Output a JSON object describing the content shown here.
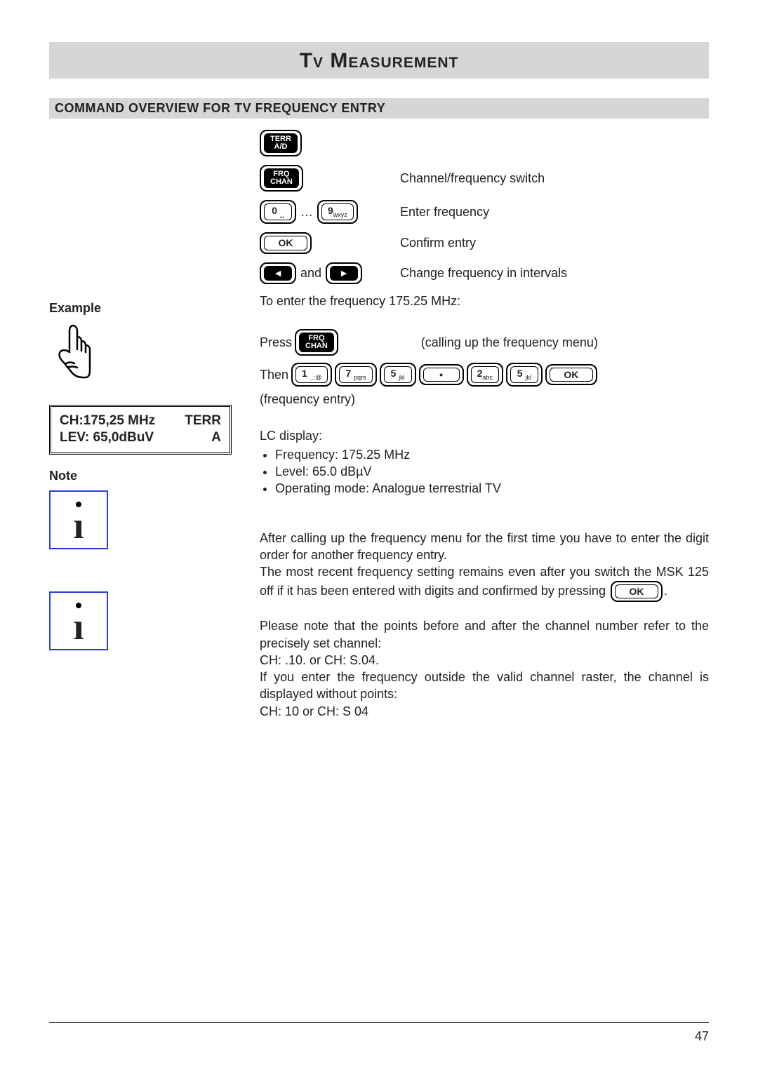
{
  "title": "Tv Measurement",
  "section_heading": "Command Overview for TV Frequency Entry",
  "commands": {
    "terr_key_line1": "TERR",
    "terr_key_line2": "A/D",
    "frq_key_line1": "FRQ",
    "frq_key_line2": "CHAN",
    "frq_desc": "Channel/frequency switch",
    "zero_key": "0",
    "zero_sub": "␣",
    "ellipsis": "…",
    "nine_key": "9",
    "nine_sub": "wxyz",
    "digits_desc": "Enter frequency",
    "ok_key": "OK",
    "ok_desc": "Confirm entry",
    "left_arrow": "◄",
    "and_word": "and",
    "right_arrow": "►",
    "arrows_desc": "Change frequency in intervals"
  },
  "example": {
    "label": "Example",
    "intro": "To enter the frequency 175.25 MHz:",
    "press_word": "Press",
    "press_desc": "(calling up the frequency menu)",
    "then_word": "Then",
    "k1": "1",
    "k1_sub": "..:@",
    "k7": "7",
    "k7_sub": "pqrs",
    "k5": "5",
    "k5_sub": "jkl",
    "kdot": "•",
    "k2": "2",
    "k2_sub": "abc",
    "k5b": "5",
    "k5b_sub": "jkl",
    "kok": "OK",
    "freq_entry_note": "(frequency entry)"
  },
  "lcd": {
    "line1_left": "CH:175,25 MHz",
    "line1_right": "TERR",
    "line2_left": "LEV: 65,0dBuV",
    "line2_right": "A"
  },
  "lcd_text": {
    "heading": "LC display:",
    "b1": "Frequency: 175.25 MHz",
    "b2": "Level: 65.0 dBµV",
    "b3": "Operating mode: Analogue terrestrial TV"
  },
  "note": {
    "label": "Note",
    "p1": "After calling up the frequency menu for the first time you have to enter the digit order for another frequency entry.",
    "p2_a": "The most recent frequency setting remains even after you switch the MSK 125 off if it has been entered with digits and confirmed by pressing ",
    "p2_ok": "OK",
    "p2_b": ".",
    "p3": "Please note that the points before and after the channel number refer to the precisely set channel:",
    "p3_ex": "CH: .10.  or  CH: S.04.",
    "p4": "If you enter the frequency outside the valid channel raster, the channel is displayed without points:",
    "p4_ex": "CH:  10  or  CH: S 04"
  },
  "page_number": "47"
}
